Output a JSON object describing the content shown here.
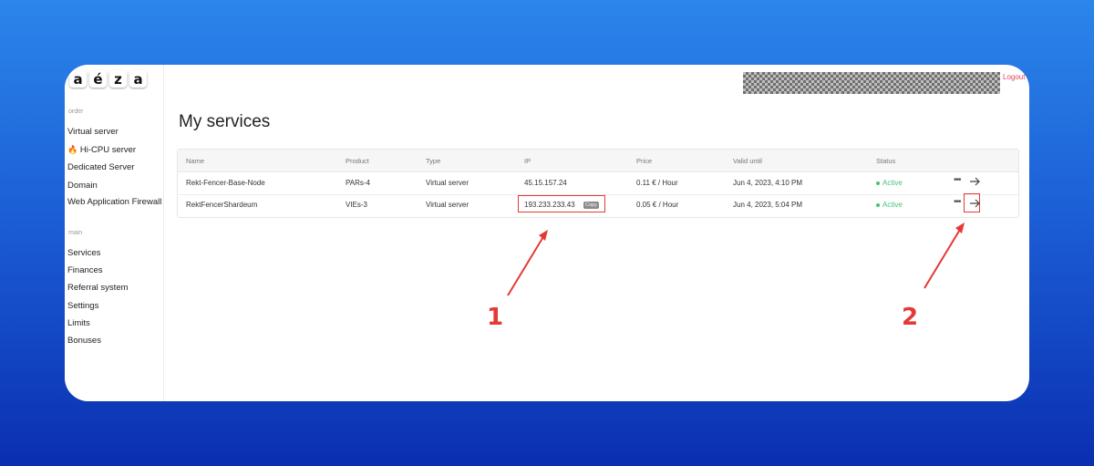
{
  "logo": {
    "letters": [
      "a",
      "é",
      "z",
      "a"
    ]
  },
  "sidebar": {
    "order_label": "order",
    "order_items": [
      {
        "label": "Virtual server"
      },
      {
        "label": "Hi-CPU server",
        "icon": "fire-icon"
      },
      {
        "label": "Dedicated Server"
      },
      {
        "label": "Domain"
      },
      {
        "label": "Web Application Firewall"
      }
    ],
    "main_label": "main",
    "main_items": [
      {
        "label": "Services"
      },
      {
        "label": "Finances"
      },
      {
        "label": "Referral system"
      },
      {
        "label": "Settings"
      },
      {
        "label": "Limits"
      },
      {
        "label": "Bonuses"
      }
    ]
  },
  "header": {
    "logout": "Logout"
  },
  "page": {
    "title": "My services"
  },
  "table": {
    "columns": [
      "Name",
      "Product",
      "Type",
      "IP",
      "Price",
      "Valid until",
      "Status"
    ],
    "rows": [
      {
        "name": "Rekt-Fencer-Base-Node",
        "product": "PARs-4",
        "type": "Virtual server",
        "ip": "45.15.157.24",
        "price": "0.11 € / Hour",
        "valid_until": "Jun 4, 2023, 4:10 PM",
        "status": "Active"
      },
      {
        "name": "RektFencerShardeum",
        "product": "VIEs-3",
        "type": "Virtual server",
        "ip": "193.233.233.43",
        "copy_label": "Copy",
        "price": "0.05 € / Hour",
        "valid_until": "Jun 4, 2023, 5:04 PM",
        "status": "Active"
      }
    ]
  },
  "annotations": {
    "label_1": "1",
    "label_2": "2",
    "color": "#e53935"
  },
  "colors": {
    "accent": "#e0435a",
    "status_active": "#46c37b",
    "annotation": "#e53935"
  }
}
